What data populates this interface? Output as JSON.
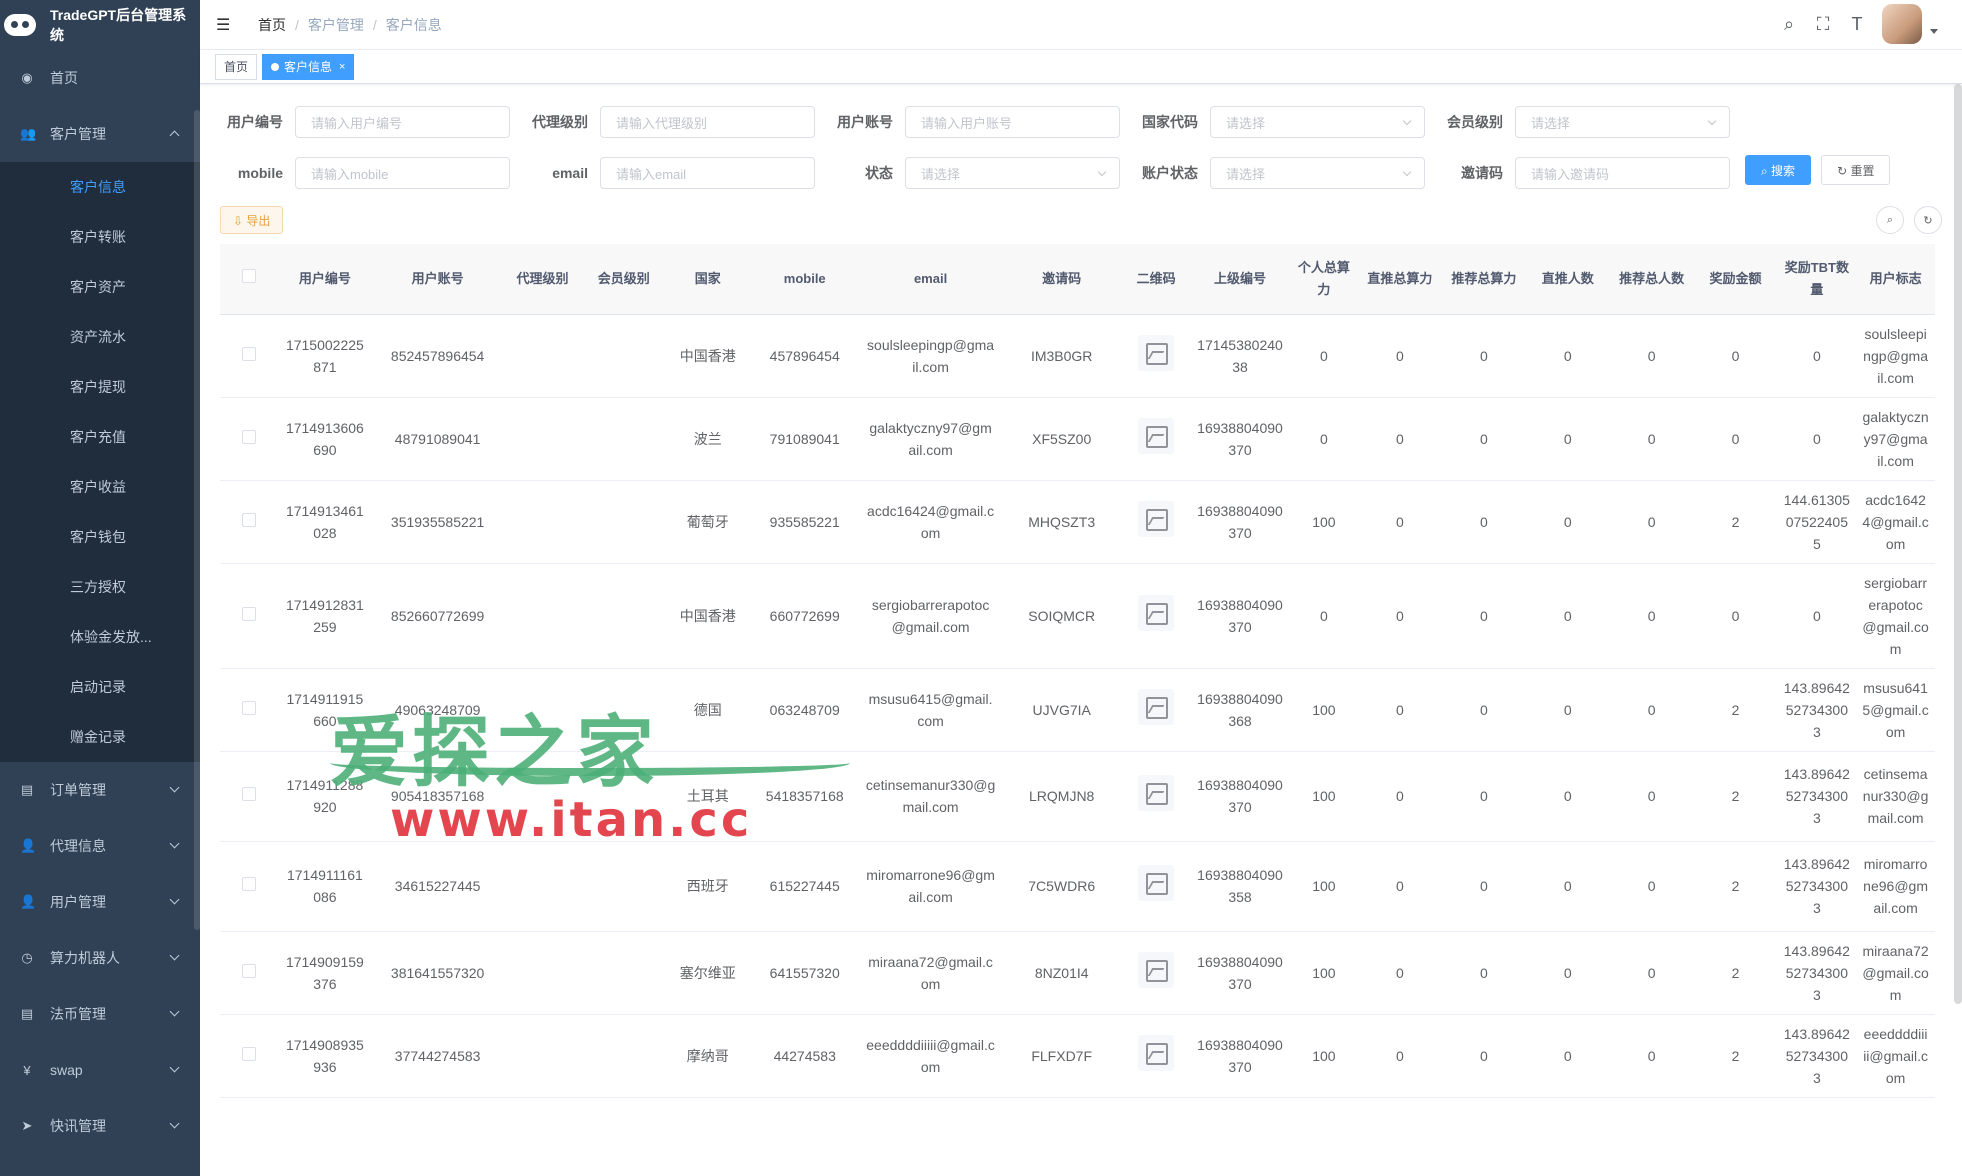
{
  "app": {
    "brand": "TradeGPT后台管理系统"
  },
  "sidebar": {
    "items": [
      {
        "label": "首页",
        "icon": "dashboard-icon",
        "glyph": "◉"
      },
      {
        "label": "客户管理",
        "icon": "user-icon",
        "glyph": "👥"
      }
    ],
    "subitems": [
      "客户信息",
      "客户转账",
      "客户资产",
      "资产流水",
      "客户提现",
      "客户充值",
      "客户收益",
      "客户钱包",
      "三方授权",
      "体验金发放...",
      "启动记录",
      "赠金记录"
    ],
    "bottom_items": [
      {
        "label": "订单管理",
        "icon": "document-icon",
        "glyph": "▤"
      },
      {
        "label": "代理信息",
        "icon": "user-icon",
        "glyph": "👤"
      },
      {
        "label": "用户管理",
        "icon": "user-icon",
        "glyph": "👤"
      },
      {
        "label": "算力机器人",
        "icon": "clock-icon",
        "glyph": "◷"
      },
      {
        "label": "法币管理",
        "icon": "document-icon",
        "glyph": "▤"
      },
      {
        "label": "swap",
        "icon": "yen-icon",
        "glyph": "¥"
      },
      {
        "label": "快讯管理",
        "icon": "send-icon",
        "glyph": "➤"
      }
    ]
  },
  "navbar": {
    "breadcrumb": [
      "首页",
      "客户管理",
      "客户信息"
    ],
    "icons": {
      "search": "⌕",
      "fullscreen": "⛶",
      "size": "T"
    }
  },
  "tags": {
    "home": "首页",
    "current": "客户信息",
    "close": "×"
  },
  "filters": {
    "row1": [
      {
        "label": "用户编号",
        "placeholder": "请输入用户编号",
        "select": false
      },
      {
        "label": "代理级别",
        "placeholder": "请输入代理级别",
        "select": false
      },
      {
        "label": "用户账号",
        "placeholder": "请输入用户账号",
        "select": false
      },
      {
        "label": "国家代码",
        "placeholder": "请选择",
        "select": true
      },
      {
        "label": "会员级别",
        "placeholder": "请选择",
        "select": true
      }
    ],
    "row2": [
      {
        "label": "mobile",
        "placeholder": "请输入mobile",
        "select": false
      },
      {
        "label": "email",
        "placeholder": "请输入email",
        "select": false
      },
      {
        "label": "状态",
        "placeholder": "请选择",
        "select": true
      },
      {
        "label": "账户状态",
        "placeholder": "请选择",
        "select": true
      },
      {
        "label": "邀请码",
        "placeholder": "请输入邀请码",
        "select": false
      }
    ],
    "search_label": "⌕ 搜索",
    "reset_label": "↻ 重置"
  },
  "toolbar": {
    "export_label": "⇩ 导出"
  },
  "table": {
    "headers": [
      "用户编号",
      "用户账号",
      "代理级别",
      "会员级别",
      "国家",
      "mobile",
      "email",
      "邀请码",
      "二维码",
      "上级编号",
      "个人总算力",
      "直推总算力",
      "推荐总算力",
      "直推人数",
      "推荐总人数",
      "奖励金额",
      "奖励TBT数量",
      "用户标志"
    ],
    "rows": [
      [
        "1715002225871",
        "852457896454",
        "",
        "",
        "中国香港",
        "457896454",
        "soulsleepingp@gmail.com",
        "IM3B0GR",
        "",
        "1714538024038",
        "0",
        "0",
        "0",
        "0",
        "0",
        "0",
        "0",
        "soulsleepingp@gmail.com"
      ],
      [
        "1714913606690",
        "48791089041",
        "",
        "",
        "波兰",
        "791089041",
        "galaktyczny97@gmail.com",
        "XF5SZ00",
        "",
        "16938804090370",
        "0",
        "0",
        "0",
        "0",
        "0",
        "0",
        "0",
        "galaktyczny97@gmail.com"
      ],
      [
        "1714913461028",
        "351935585221",
        "",
        "",
        "葡萄牙",
        "935585221",
        "acdc16424@gmail.com",
        "MHQSZT3",
        "",
        "16938804090370",
        "100",
        "0",
        "0",
        "0",
        "0",
        "2",
        "144.61305075224055",
        "acdc16424@gmail.com"
      ],
      [
        "1714912831259",
        "852660772699",
        "",
        "",
        "中国香港",
        "660772699",
        "sergiobarrerapotoc@gmail.com",
        "SOIQMCR",
        "",
        "16938804090370",
        "0",
        "0",
        "0",
        "0",
        "0",
        "0",
        "0",
        "sergiobarrerapotoc@gmail.com"
      ],
      [
        "1714911915660",
        "49063248709",
        "",
        "",
        "德国",
        "063248709",
        "msusu6415@gmail.com",
        "UJVG7IA",
        "",
        "16938804090368",
        "100",
        "0",
        "0",
        "0",
        "0",
        "2",
        "143.89642527343003",
        "msusu6415@gmail.com"
      ],
      [
        "1714911288920",
        "905418357168",
        "",
        "",
        "土耳其",
        "5418357168",
        "cetinsemanur330@gmail.com",
        "LRQMJN8",
        "",
        "16938804090370",
        "100",
        "0",
        "0",
        "0",
        "0",
        "2",
        "143.89642527343003",
        "cetinsemanur330@gmail.com"
      ],
      [
        "1714911161086",
        "34615227445",
        "",
        "",
        "西班牙",
        "615227445",
        "miromarrone96@gmail.com",
        "7C5WDR6",
        "",
        "16938804090358",
        "100",
        "0",
        "0",
        "0",
        "0",
        "2",
        "143.89642527343003",
        "miromarrone96@gmail.com"
      ],
      [
        "1714909159376",
        "381641557320",
        "",
        "",
        "塞尔维亚",
        "641557320",
        "miraana72@gmail.com",
        "8NZ01I4",
        "",
        "16938804090370",
        "100",
        "0",
        "0",
        "0",
        "0",
        "2",
        "143.89642527343003",
        "miraana72@gmail.com"
      ],
      [
        "1714908935936",
        "37744274583",
        "",
        "",
        "摩纳哥",
        "44274583",
        "eeeddddiiiii@gmail.com",
        "FLFXD7F",
        "",
        "16938804090370",
        "100",
        "0",
        "0",
        "0",
        "0",
        "2",
        "143.89642527343003",
        "eeeddddiiiii@gmail.com"
      ]
    ]
  },
  "watermark": {
    "cn": "爱探之家",
    "url": "www.itan.cc"
  }
}
